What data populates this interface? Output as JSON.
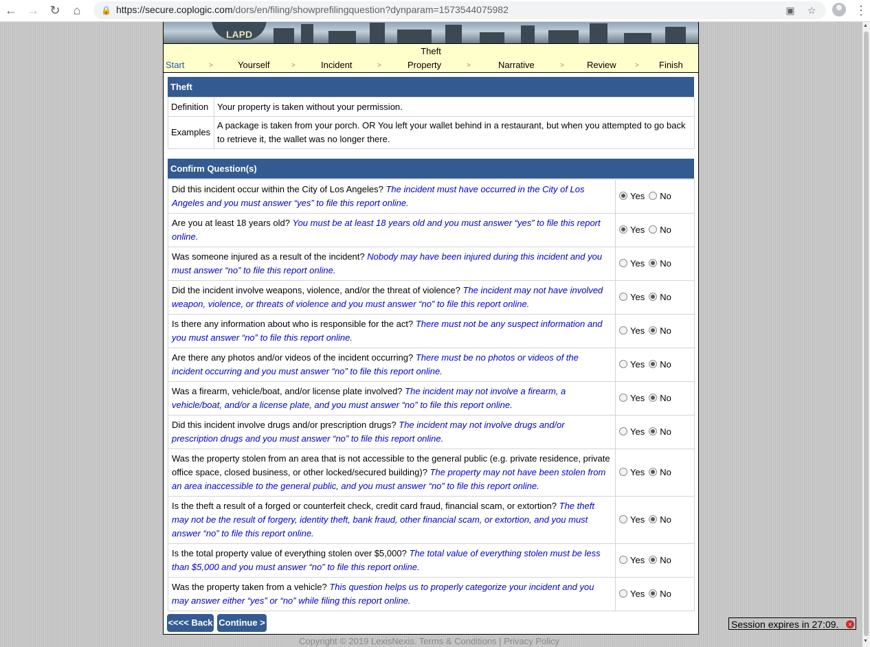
{
  "browser": {
    "url_host": "https://secure.coplogic.com",
    "url_path": "/dors/en/filing/showprefilingquestion?dynparam=1573544075982"
  },
  "banner": {
    "logo_text": "LAPD"
  },
  "page_title": "Theft",
  "steps": [
    "Start",
    "Yourself",
    "Incident",
    "Property",
    "Narrative",
    "Review",
    "Finish"
  ],
  "definition_section": {
    "header": "Theft",
    "definition_label": "Definition",
    "definition_text": "Your property is taken without your permission.",
    "examples_label": "Examples",
    "examples_text": "A package is taken from your porch. OR You left your wallet behind in a restaurant, but when you attempted to go back to retrieve it, the wallet was no longer there."
  },
  "confirm_section": {
    "header": "Confirm Question(s)",
    "yes_label": "Yes",
    "no_label": "No",
    "questions": [
      {
        "question": "Did this incident occur within the City of Los Angeles?",
        "note": "The incident must have occurred in the City of Los Angeles and you must answer “yes” to file this report online.",
        "answer": "Yes"
      },
      {
        "question": "Are you at least 18 years old?",
        "note": "You must be at least 18 years old and you must answer “yes” to file this report online.",
        "answer": "Yes"
      },
      {
        "question": "Was someone injured as a result of the incident?",
        "note": "Nobody may have been injured during this incident and you must answer “no” to file this report online.",
        "answer": "No"
      },
      {
        "question": "Did the incident involve weapons, violence, and/or the threat of violence?",
        "note": "The incident may not have involved weapon, violence, or threats of violence and you must answer “no” to file this report online.",
        "answer": "No"
      },
      {
        "question": "Is there any information about who is responsible for the act?",
        "note": "There must not be any suspect information and you must answer “no” to file this report online.",
        "answer": "No"
      },
      {
        "question": "Are there any photos and/or videos of the incident occurring?",
        "note": "There must be no photos or videos of the incident occurring and you must answer “no” to file this report online.",
        "answer": "No"
      },
      {
        "question": "Was a firearm, vehicle/boat, and/or license plate involved?",
        "note": "The incident may not involve a firearm, a vehicle/boat, and/or a license plate, and you must answer “no” to file this report online.",
        "answer": "No"
      },
      {
        "question": "Did this incident involve drugs and/or prescription drugs?",
        "note": "The incident may not involve drugs and/or prescription drugs and you must answer “no” to file this report online.",
        "answer": "No"
      },
      {
        "question": "Was the property stolen from an area that is not accessible to the general public (e.g. private residence, private office space, closed business, or other locked/secured building)?",
        "note": "The property may not have been stolen from an area inaccessible to the general public, and you must answer “no” to file this report online.",
        "answer": "No"
      },
      {
        "question": "Is the theft a result of a forged or counterfeit check, credit card fraud, financial scam, or extortion?",
        "note": "The theft may not be the result of forgery, identity theft, bank fraud, other financial scam, or extortion, and you must answer “no” to file this report online.",
        "answer": "No"
      },
      {
        "question": "Is the total property value of everything stolen over $5,000?",
        "note": "The total value of everything stolen must be less than $5,000 and you must answer “no” to file this report online.",
        "answer": "No"
      },
      {
        "question": "Was the property taken from a vehicle?",
        "note": "This question helps us to properly categorize your incident and you may answer either “yes” or “no” while filing this report online.",
        "answer": "No"
      }
    ]
  },
  "buttons": {
    "back": "<<<< Back",
    "continue": "Continue >"
  },
  "footer": "Copyright ©  2019 LexisNexis. Terms & Conditions  |  Privacy Policy",
  "session": "Session expires in 27:09."
}
